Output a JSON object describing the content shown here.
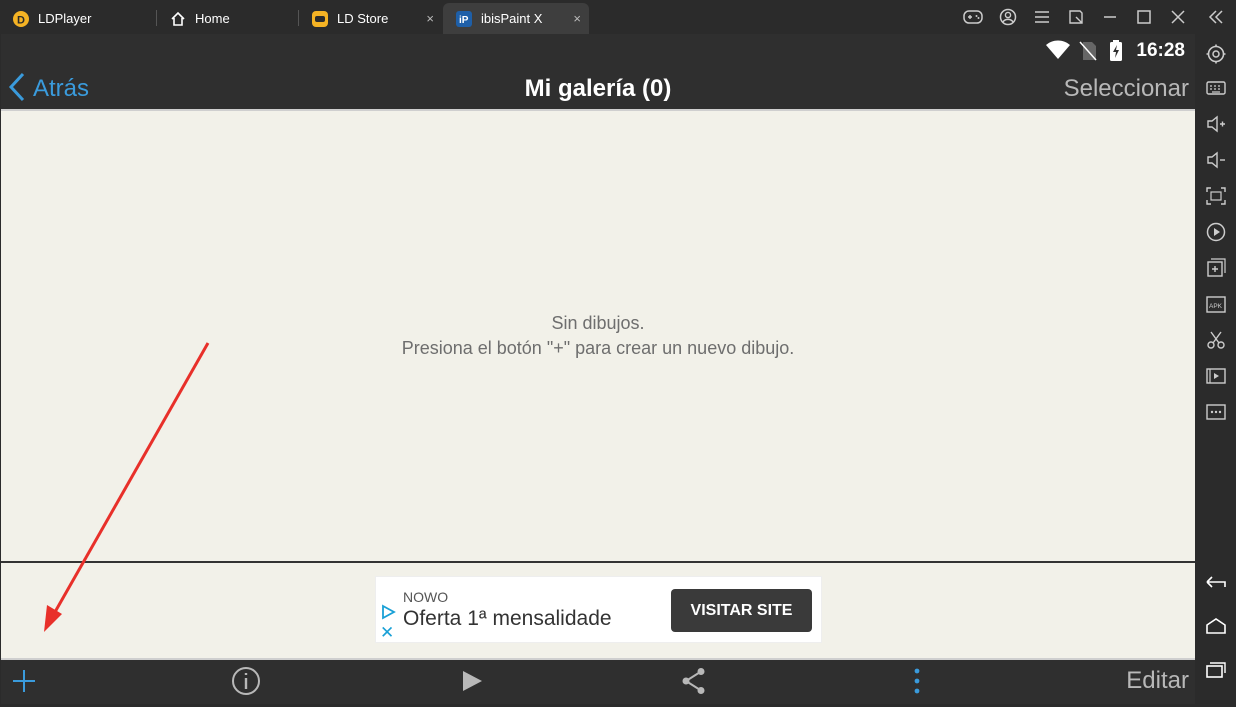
{
  "titlebar": {
    "tabs": [
      {
        "label": "LDPlayer",
        "icon": "ldplayer-logo-icon"
      },
      {
        "label": "Home",
        "icon": "home-icon"
      },
      {
        "label": "LD Store",
        "icon": "gamepad-store-icon",
        "close": "×"
      },
      {
        "label": "ibisPaint X",
        "icon": "ibispaint-icon",
        "close": "×",
        "active": true
      }
    ],
    "controls": [
      "gamepad-icon",
      "account-icon",
      "menu-icon",
      "popout-icon",
      "minimize-icon",
      "maximize-icon",
      "close-icon",
      "collapse-icon"
    ]
  },
  "sidepanel": {
    "items": [
      "settings-icon",
      "keyboard-icon",
      "volume-up-icon",
      "volume-down-icon",
      "fullscreen-icon",
      "record-icon",
      "add-window-icon",
      "apk-icon",
      "scissors-icon",
      "video-icon",
      "more-icon",
      "back-icon",
      "home-icon",
      "recents-icon"
    ]
  },
  "statusbar": {
    "time": "16:28"
  },
  "navbar": {
    "back_label": "Atrás",
    "title": "Mi galería (0)",
    "select_label": "Seleccionar"
  },
  "empty": {
    "line1": "Sin dibujos.",
    "line2": "Presiona el botón \"+\" para crear un nuevo dibujo."
  },
  "ad": {
    "brand": "NOWO",
    "headline": "Oferta 1ª mensalidade",
    "cta": "VISITAR SITE"
  },
  "toolbar": {
    "edit_label": "Editar"
  },
  "colors": {
    "accent": "#3a9bdc",
    "background": "#f2f1e9",
    "bar": "#2f2f2f",
    "annotation_arrow": "#e8302a"
  }
}
